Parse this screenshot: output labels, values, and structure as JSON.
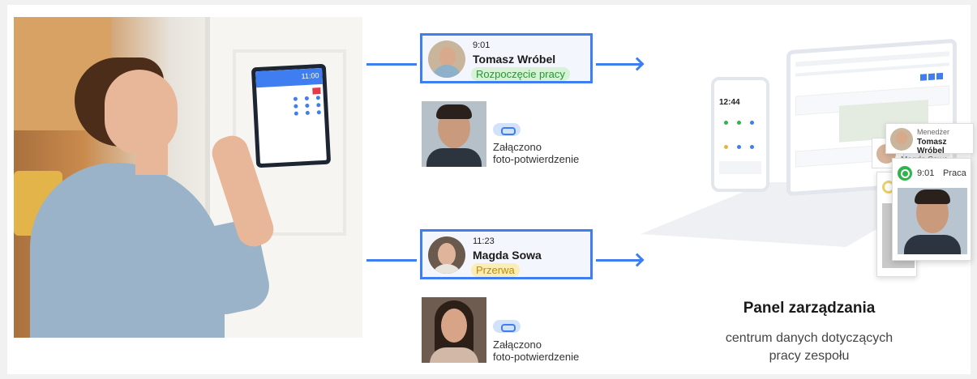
{
  "tablet": {
    "time": "11:00"
  },
  "cards": [
    {
      "time": "9:01",
      "name": "Tomasz Wróbel",
      "status": "Rozpoczęcie pracy",
      "status_color": "#1f9a2f"
    },
    {
      "time": "11:23",
      "name": "Magda Sowa",
      "status": "Przerwa",
      "status_color": "#c28c00"
    }
  ],
  "attachments": [
    {
      "label_line1": "Załączono",
      "label_line2": "foto-potwierdzenie"
    },
    {
      "label_line1": "Załączono",
      "label_line2": "foto-potwierdzenie"
    }
  ],
  "phone": {
    "clock": "12:44"
  },
  "manager_card": {
    "role": "Menedżer",
    "name": "Tomasz Wróbel"
  },
  "back_card": {
    "name": "Magda Sowa"
  },
  "work_card": {
    "time": "9:01",
    "label": "Praca"
  },
  "panel": {
    "title": "Panel zarządzania",
    "subtitle_line1": "centrum danych dotyczących",
    "subtitle_line2": "pracy zespołu"
  },
  "colors": {
    "accent": "#3f7ef0",
    "green": "#1f9a2f",
    "yellow": "#c28c00"
  }
}
